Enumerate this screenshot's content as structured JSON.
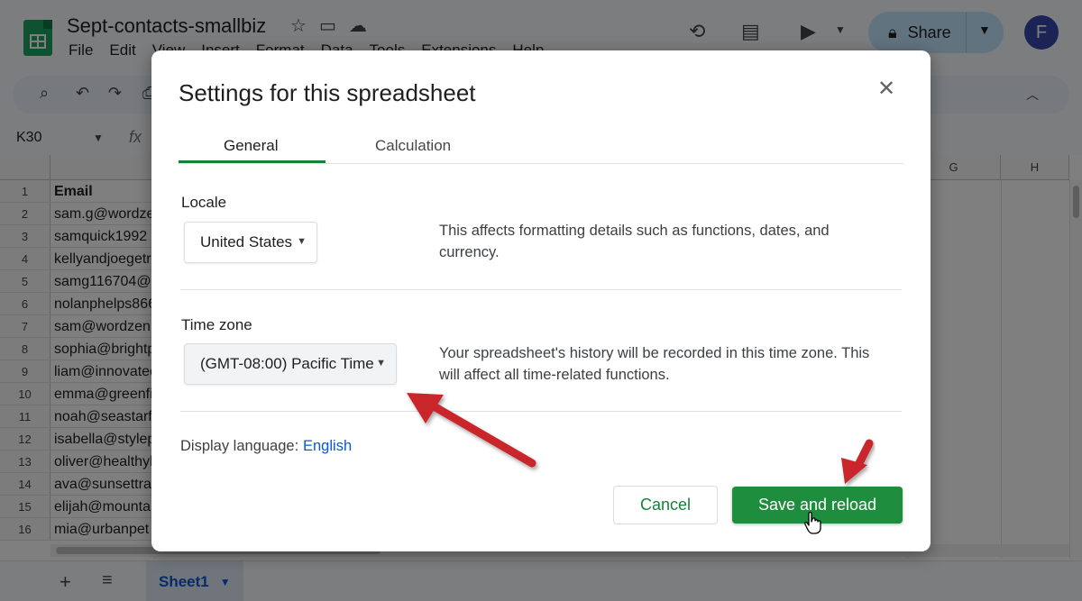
{
  "app": {
    "doc_title": "Sept-contacts-smallbiz",
    "menu": [
      "File",
      "Edit",
      "View",
      "Insert",
      "Format",
      "Data",
      "Tools",
      "Extensions",
      "Help"
    ],
    "share_label": "Share",
    "avatar_initial": "F",
    "name_box": "K30",
    "fx": "fx"
  },
  "grid": {
    "columns_visible": [
      "G",
      "H"
    ],
    "rows": [
      {
        "n": "1",
        "email": "Email"
      },
      {
        "n": "2",
        "email": "sam.g@wordze"
      },
      {
        "n": "3",
        "email": "samquick1992"
      },
      {
        "n": "4",
        "email": "kellyandjoegetr"
      },
      {
        "n": "5",
        "email": "samg116704@"
      },
      {
        "n": "6",
        "email": "nolanphelps866"
      },
      {
        "n": "7",
        "email": "sam@wordzen"
      },
      {
        "n": "8",
        "email": "sophia@brightp"
      },
      {
        "n": "9",
        "email": "liam@innovated"
      },
      {
        "n": "10",
        "email": "emma@greenfi"
      },
      {
        "n": "11",
        "email": "noah@seastarf"
      },
      {
        "n": "12",
        "email": "isabella@stylep"
      },
      {
        "n": "13",
        "email": "oliver@healthyl"
      },
      {
        "n": "14",
        "email": "ava@sunsettra"
      },
      {
        "n": "15",
        "email": "elijah@mounta"
      },
      {
        "n": "16",
        "email": "mia@urbanpet"
      }
    ]
  },
  "sheet_tab": "Sheet1",
  "dialog": {
    "title": "Settings for this spreadsheet",
    "tabs": [
      "General",
      "Calculation"
    ],
    "locale": {
      "label": "Locale",
      "value": "United States",
      "description": "This affects formatting details such as functions, dates, and currency."
    },
    "timezone": {
      "label": "Time zone",
      "value": "(GMT-08:00) Pacific Time",
      "description": "Your spreadsheet's history will be recorded in this time zone. This will affect all time-related functions."
    },
    "display_language": {
      "label": "Display language:",
      "value": "English"
    },
    "cancel_label": "Cancel",
    "save_label": "Save and reload"
  },
  "colors": {
    "accent_green": "#1e8e3e",
    "tab_underline": "#188038",
    "link_blue": "#0b57d0",
    "annotation_red": "#c8262c",
    "share_bg": "#c2e7ff"
  }
}
